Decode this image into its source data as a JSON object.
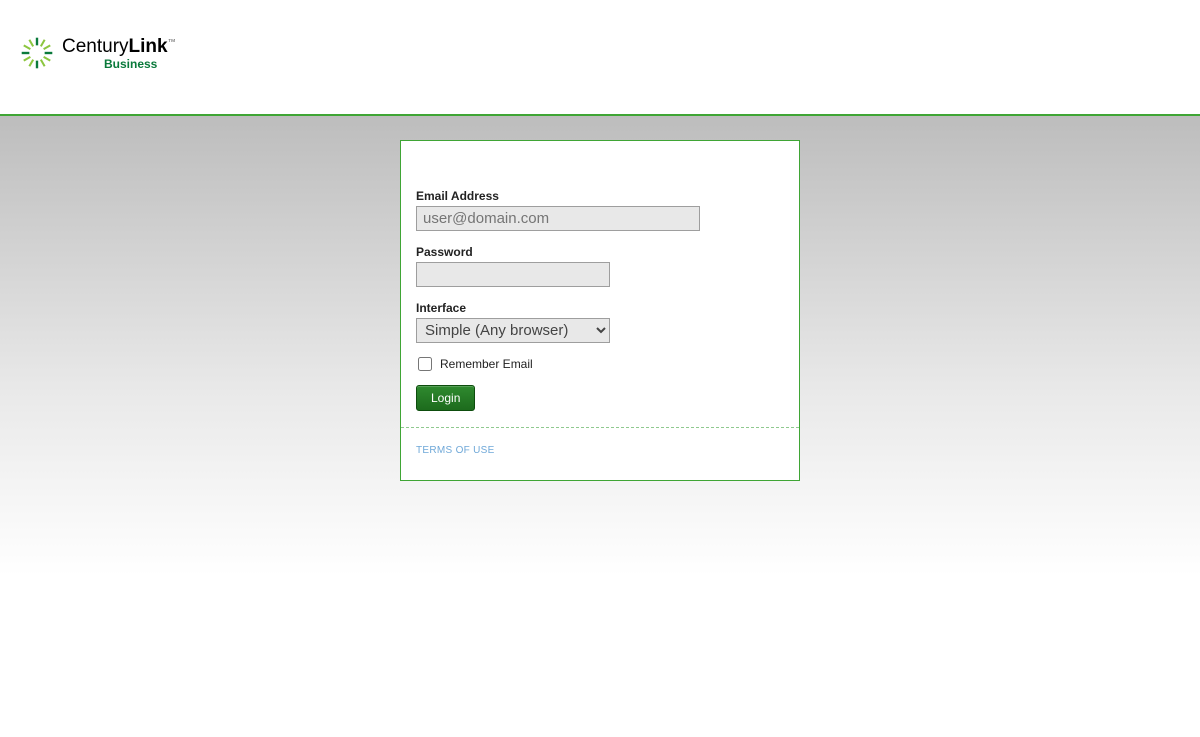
{
  "brand": {
    "name_plain": "Century",
    "name_bold": "Link",
    "tm": "™",
    "subtitle": "Business"
  },
  "form": {
    "email_label": "Email Address",
    "email_placeholder": "user@domain.com",
    "email_value": "",
    "password_label": "Password",
    "password_value": "",
    "interface_label": "Interface",
    "interface_selected": "Simple (Any browser)",
    "remember_label": "Remember Email",
    "login_button": "Login"
  },
  "footer": {
    "terms_label": "TERMS OF USE"
  },
  "colors": {
    "brand_green": "#3fa535",
    "dark_green": "#0a7a3b"
  }
}
